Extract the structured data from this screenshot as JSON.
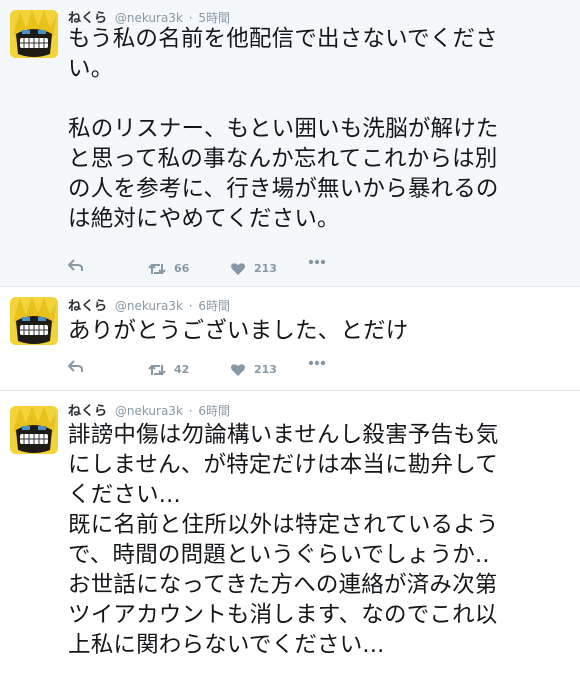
{
  "tweets": [
    {
      "name": "ねくら",
      "handle": "@nekura3k",
      "separator": "·",
      "time": "5時間",
      "text": "もう私の名前を他配信で出さないでくださ\nい。\n\n私のリスナー、もとい囲いも洗脳が解けた\nと思って私の事なんか忘れてこれからは別\nの人を参考に、行き場が無いから暴れるの\nは絶対にやめてください。",
      "retweets": "66",
      "likes": "213"
    },
    {
      "name": "ねくら",
      "handle": "@nekura3k",
      "separator": "·",
      "time": "6時間",
      "text": "ありがとうございました、とだけ",
      "retweets": "42",
      "likes": "213"
    },
    {
      "name": "ねくら",
      "handle": "@nekura3k",
      "separator": "·",
      "time": "6時間",
      "text": "誹謗中傷は勿論構いませんし殺害予告も気\nにしません、が特定だけは本当に勘弁して\nください...\n既に名前と住所以外は特定されているよう\nで、時間の問題というぐらいでしょうか..\nお世話になってきた方への連絡が済み次第\nツイアカウントも消します、なのでこれ以\n上私に関わらないでください...",
      "retweets": "",
      "likes": ""
    }
  ],
  "icons": {
    "reply": "reply-icon",
    "retweet": "retweet-icon",
    "like": "heart-icon",
    "more": "more-icon"
  },
  "colors": {
    "highlight_bg": "#f5f8fa",
    "secondary_text": "#8899a6",
    "avatar_yellow": "#f2d33a"
  }
}
